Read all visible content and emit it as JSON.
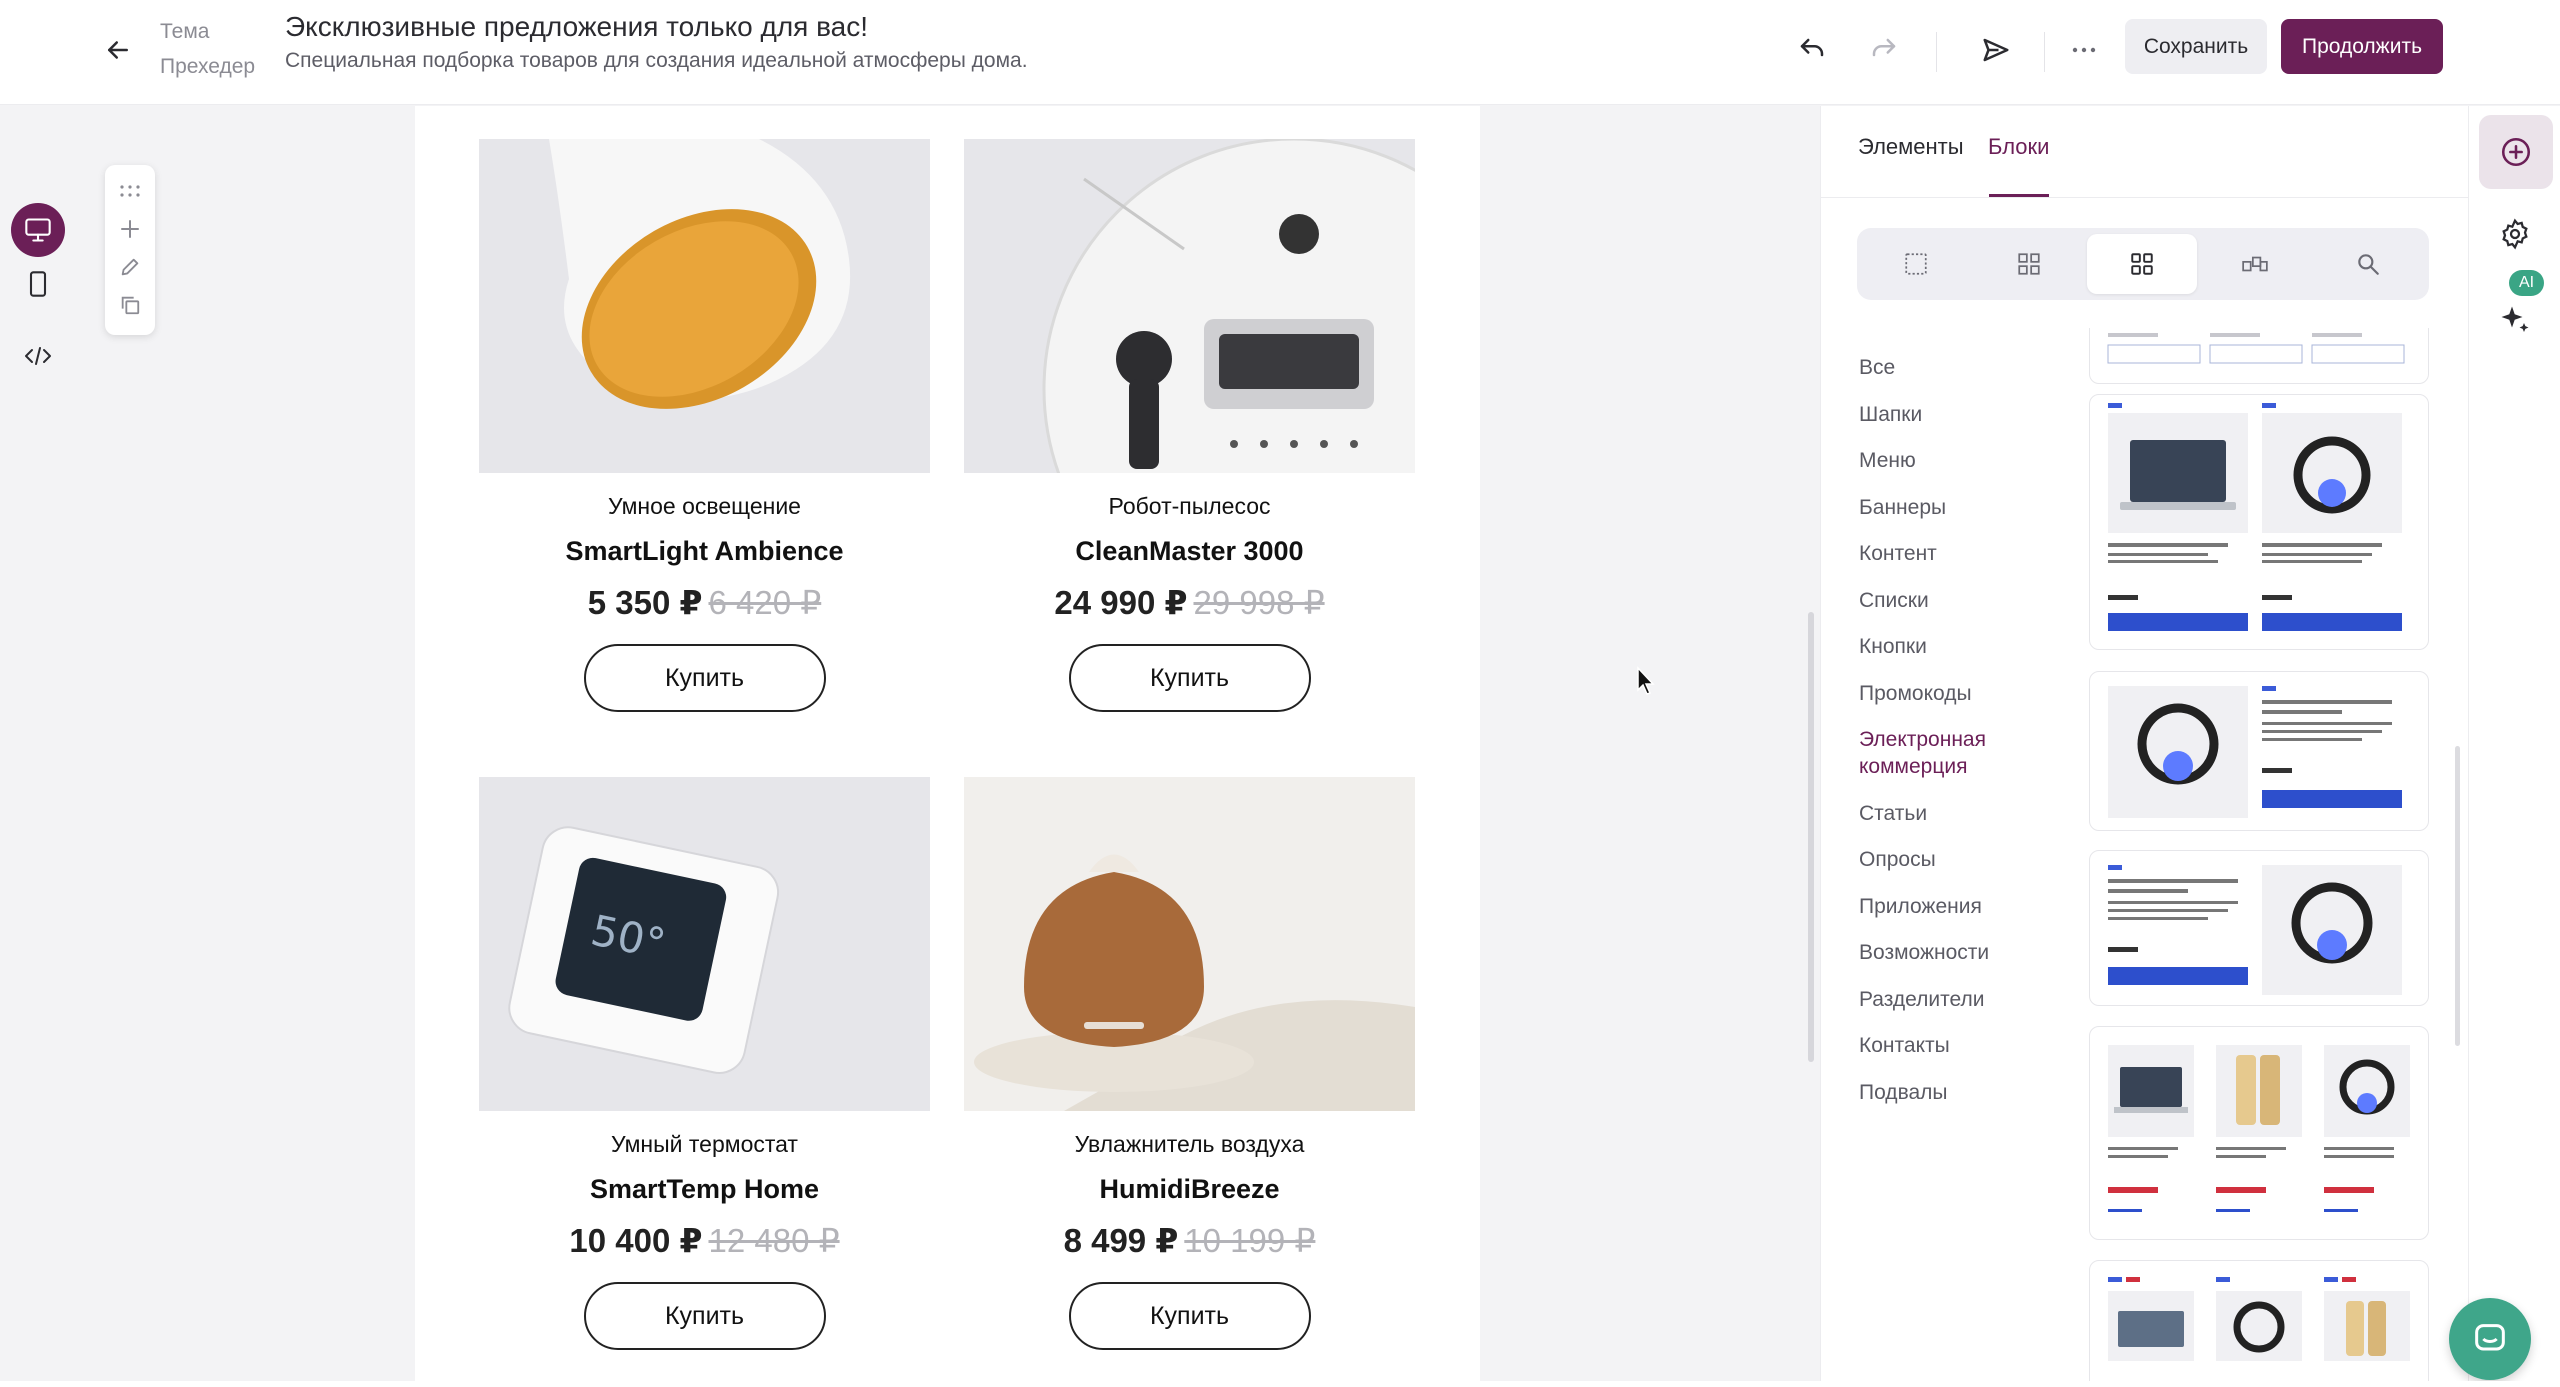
{
  "header": {
    "subject_label": "Тема",
    "preheader_label": "Прехедер",
    "subject": "Эксклюзивные предложения только для вас!",
    "preheader": "Специальная подборка товаров для создания идеальной атмосферы дома.",
    "save_label": "Сохранить",
    "continue_label": "Продолжить",
    "accent_color": "#6b1f57"
  },
  "icons": {
    "back": "arrow-left-icon",
    "undo": "undo-icon",
    "redo": "redo-icon",
    "send": "send-icon",
    "more": "more-horizontal-icon",
    "desktop": "desktop-icon",
    "mobile": "mobile-icon",
    "code": "code-icon",
    "drag": "drag-handle-icon",
    "add": "plus-icon",
    "edit": "pencil-icon",
    "duplicate": "copy-icon",
    "settings": "gear-icon",
    "ai": "sparkles-icon",
    "chat": "chat-icon"
  },
  "products": [
    {
      "category": "Умное освещение",
      "name": "SmartLight Ambience",
      "price": "5 350 ₽",
      "old_price": "6 420 ₽",
      "button": "Купить"
    },
    {
      "category": "Робот-пылесос",
      "name": "CleanMaster 3000",
      "price": "24 990 ₽",
      "old_price": "29 998 ₽",
      "button": "Купить"
    },
    {
      "category": "Умный термостат",
      "name": "SmartTemp Home",
      "price": "10 400 ₽",
      "old_price": "12 480 ₽",
      "button": "Купить"
    },
    {
      "category": "Увлажнитель воздуха",
      "name": "HumidiBreeze",
      "price": "8 499 ₽",
      "old_price": "10 199 ₽",
      "button": "Купить"
    }
  ],
  "panel": {
    "tabs": [
      "Элементы",
      "Блоки"
    ],
    "active_tab": "Блоки",
    "categories": [
      "Все",
      "Шапки",
      "Меню",
      "Баннеры",
      "Контент",
      "Списки",
      "Кнопки",
      "Промокоды",
      "Электронная коммерция",
      "Статьи",
      "Опросы",
      "Приложения",
      "Возможности",
      "Разделители",
      "Контакты",
      "Подвалы"
    ],
    "active_category": "Электронная коммерция",
    "ai_badge": "AI"
  }
}
